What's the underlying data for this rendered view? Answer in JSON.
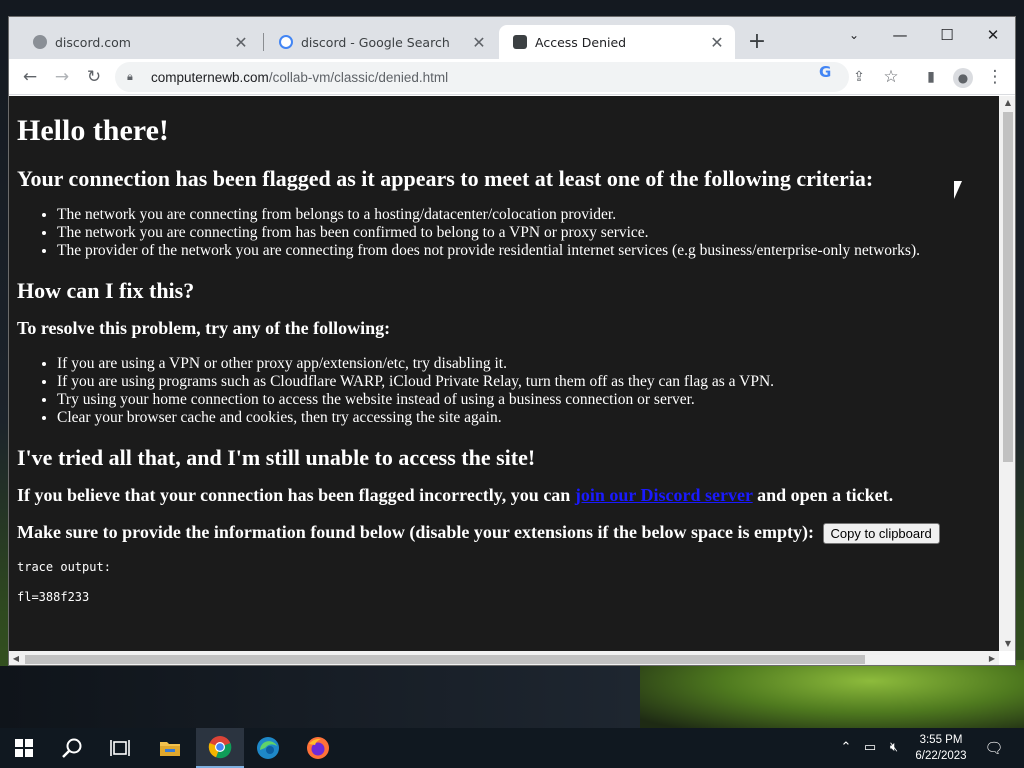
{
  "tabs": [
    {
      "title": "discord.com",
      "icon": "globe-icon",
      "active": false
    },
    {
      "title": "discord - Google Search",
      "icon": "google-icon",
      "active": false
    },
    {
      "title": "Access Denied",
      "icon": "computernewb-icon",
      "active": true
    }
  ],
  "address_bar": {
    "domain": "computernewb.com",
    "path": "/collab-vm/classic/denied.html"
  },
  "page": {
    "heading": "Hello there!",
    "flag_heading": "Your connection has been flagged as it appears to meet at least one of the following criteria:",
    "criteria": [
      "The network you are connecting from belongs to a hosting/datacenter/colocation provider.",
      "The network you are connecting from has been confirmed to belong to a VPN or proxy service.",
      "The provider of the network you are connecting from does not provide residential internet services (e.g business/enterprise-only networks)."
    ],
    "fix_heading": "How can I fix this?",
    "resolve_heading": "To resolve this problem, try any of the following:",
    "fixes": [
      "If you are using a VPN or other proxy app/extension/etc, try disabling it.",
      "If you are using programs such as Cloudflare WARP, iCloud Private Relay, turn them off as they can flag as a VPN.",
      "Try using your home connection to access the website instead of using a business connection or server.",
      "Clear your browser cache and cookies, then try accessing the site again."
    ],
    "tried_heading": "I've tried all that, and I'm still unable to access the site!",
    "incorrect_prefix": "If you believe that your connection has been flagged incorrectly, you can ",
    "discord_link": "join our Discord server",
    "incorrect_suffix": " and open a ticket.",
    "provide_text": "Make sure to provide the information found below (disable your extensions if the below space is empty):",
    "copy_button": "Copy to clipboard",
    "trace_label": "trace output:",
    "trace_line": "fl=388f233"
  },
  "taskbar": {
    "time": "3:55 PM",
    "date": "6/22/2023"
  },
  "colors": {
    "page_bg": "#1b1b1b",
    "link": "#1a1aff"
  }
}
